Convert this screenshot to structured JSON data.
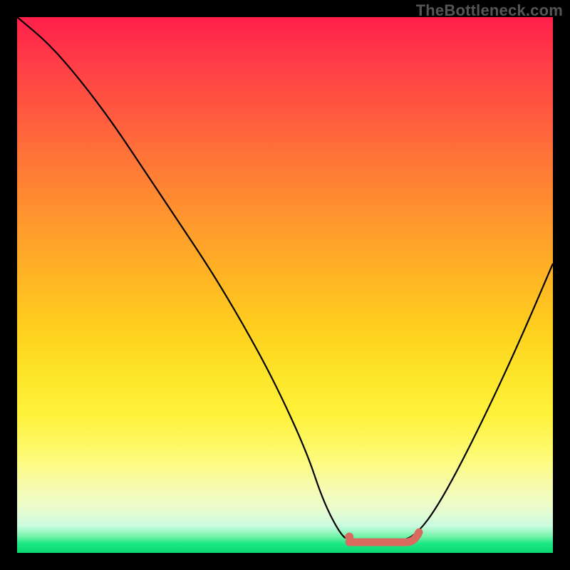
{
  "watermark": "TheBottleneck.com",
  "chart_data": {
    "type": "line",
    "title": "",
    "xlabel": "",
    "ylabel": "",
    "xlim": [
      0,
      100
    ],
    "ylim": [
      0,
      100
    ],
    "series": [
      {
        "name": "curve",
        "x": [
          0,
          6,
          12,
          18,
          24,
          30,
          36,
          42,
          48,
          54,
          57,
          60,
          62,
          72,
          75,
          78,
          82,
          88,
          94,
          100
        ],
        "y": [
          100,
          95,
          88,
          80,
          71,
          62,
          53,
          43,
          32,
          19,
          10,
          4,
          2,
          2,
          4,
          8,
          15,
          27,
          40,
          54
        ]
      }
    ],
    "annotations": [
      {
        "name": "flat-valley-highlight",
        "x_start": 62,
        "x_end": 75,
        "y": 2
      },
      {
        "name": "valley-dot",
        "x": 62,
        "y": 3
      }
    ],
    "colors": {
      "curve_stroke": "#000000",
      "highlight": "#d86a5f"
    }
  }
}
